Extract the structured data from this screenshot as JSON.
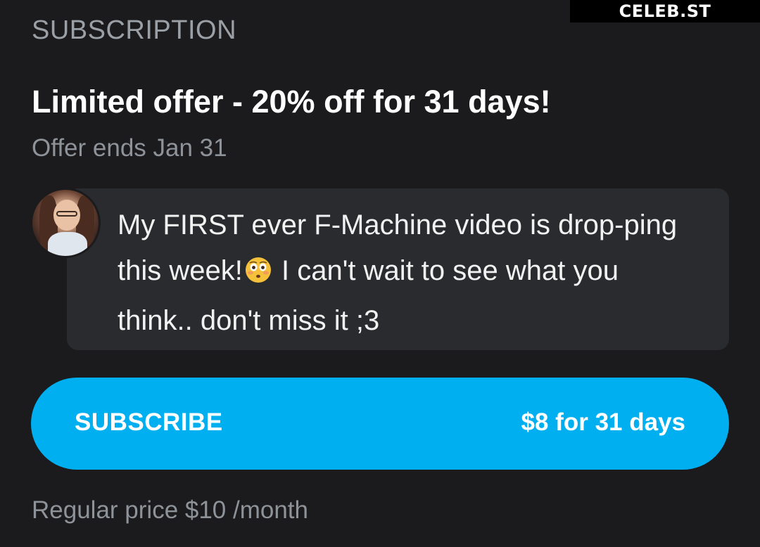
{
  "watermark": {
    "text": "CELEB.ST"
  },
  "subscription": {
    "section_label": "SUBSCRIPTION",
    "offer_title": "Limited offer - 20% off for 31 days!",
    "offer_ends": "Offer ends Jan 31",
    "message": {
      "avatar_icon": "creator-avatar",
      "text_before_emoji": "My FIRST ever F-Machine video is drop-ping this week!",
      "emoji": "flushed-face-emoji",
      "text_after_emoji": " I can't wait to see what you think.. don't miss it ;3"
    },
    "subscribe_button": {
      "label": "SUBSCRIBE",
      "price": "$8 for 31 days"
    },
    "regular_price": "Regular price $10 /month"
  },
  "colors": {
    "background": "#1b1b1d",
    "bubble": "#2a2b2e",
    "accent": "#00aff0",
    "muted_text": "#8e9399",
    "primary_text": "#ffffff"
  }
}
